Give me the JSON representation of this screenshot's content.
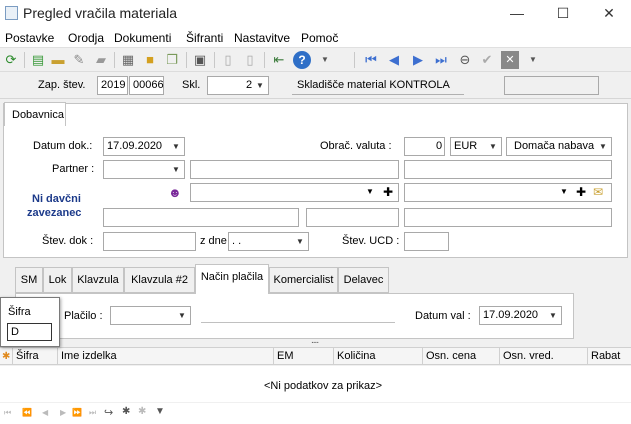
{
  "window": {
    "title": "Pregled vračila materiala",
    "controls": [
      "—",
      "☐",
      "✕"
    ]
  },
  "menu": [
    "Postavke",
    "Orodja",
    "Dokumenti",
    "Šifranti",
    "Nastavitve",
    "Pomoč"
  ],
  "header": {
    "zap_label": "Zap. štev.",
    "year": "2019",
    "number": "00066",
    "skl_label": "Skl.",
    "skl_value": "2",
    "warehouse_name": "Skladišče material KONTROLA"
  },
  "main_tab": "Dobavnica",
  "form": {
    "datum_dok_label": "Datum dok.:",
    "datum_dok": "17.09.2020",
    "obrac_valuta_label": "Obrač. valuta :",
    "valuta_rate": "0",
    "valuta": "EUR",
    "nabava": "Domača nabava",
    "partner_label": "Partner :",
    "ni_davcni": "Ni davčni",
    "zavezanec": "zavezanec",
    "stev_dok_label": "Štev. dok :",
    "z_dne_label": "z dne",
    "z_dne_value": " .  .",
    "stev_ucd_label": "Štev. UCD :"
  },
  "subtabs": [
    "SM",
    "Lok",
    "Klavzula",
    "Klavzula #2",
    "Način plačila",
    "Komercialist",
    "Delavec"
  ],
  "active_subtab": "Način plačila",
  "payment": {
    "placilo_label": "Plačilo :",
    "datum_val_label": "Datum val :",
    "datum_val": "17.09.2020"
  },
  "grid": {
    "columns": [
      "Šifra",
      "Ime izdelka",
      "EM",
      "Količina",
      "Osn. cena",
      "Osn. vred.",
      "Rabat"
    ],
    "empty_text": "<Ni podatkov za prikaz>"
  },
  "popup": {
    "label": "Šifra",
    "value": "D"
  },
  "ellipsis": "...."
}
